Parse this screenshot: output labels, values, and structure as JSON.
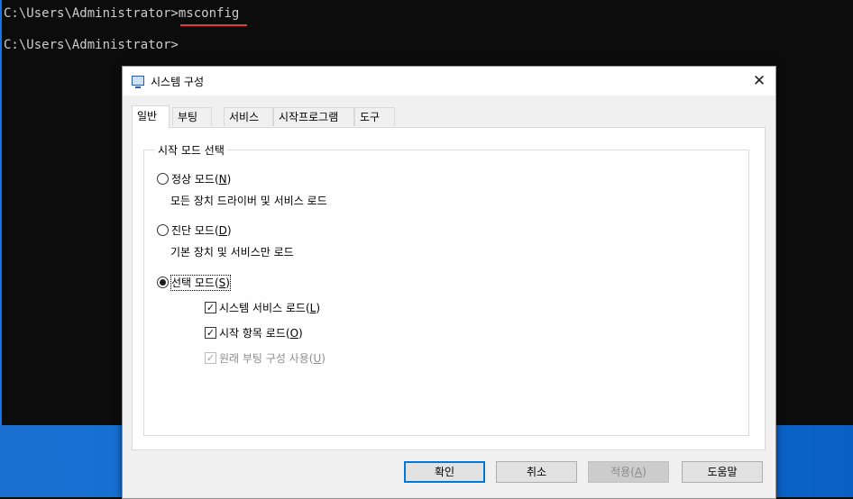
{
  "console": {
    "line1_prompt": "C:\\Users\\Administrator>",
    "line1_command": "msconfig",
    "line2_prompt": "C:\\Users\\Administrator>"
  },
  "dialog": {
    "title": "시스템 구성",
    "close_glyph": "✕",
    "tabs": [
      {
        "label": "일반",
        "active": true
      },
      {
        "label": "부팅",
        "active": false
      },
      {
        "label": "서비스",
        "active": false
      },
      {
        "label": "시작프로그램",
        "active": false
      },
      {
        "label": "도구",
        "active": false
      }
    ],
    "group_title": "시작 모드 선택",
    "options": [
      {
        "label": "정상 모드(",
        "key": "N",
        "label_end": ")",
        "description": "모든 장치 드라이버 및 서비스 로드",
        "selected": false
      },
      {
        "label": "진단 모드(",
        "key": "D",
        "label_end": ")",
        "description": "기본 장치 및 서비스만 로드",
        "selected": false
      },
      {
        "label": "선택 모드(",
        "key": "S",
        "label_end": ")",
        "selected": true
      }
    ],
    "checkboxes": [
      {
        "label": "시스템 서비스 로드(",
        "key": "L",
        "label_end": ")",
        "checked": true,
        "enabled": true
      },
      {
        "label": "시작 항목 로드(",
        "key": "O",
        "label_end": ")",
        "checked": true,
        "enabled": true
      },
      {
        "label": "원래 부팅 구성 사용(",
        "key": "U",
        "label_end": ")",
        "checked": true,
        "enabled": false
      }
    ],
    "buttons": {
      "ok": "확인",
      "cancel": "취소",
      "apply_prefix": "적용(",
      "apply_key": "A",
      "apply_suffix": ")",
      "help": "도움말"
    }
  },
  "colors": {
    "accent": "#0078d7",
    "annotation_underline": "#e53935",
    "console_bg": "#0c0c0c",
    "console_text": "#cccccc"
  }
}
